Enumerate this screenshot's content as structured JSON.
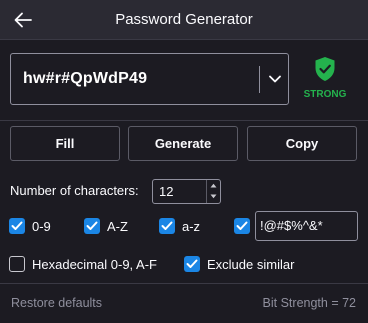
{
  "header": {
    "title": "Password Generator",
    "back_icon": "arrow-left-icon"
  },
  "password": {
    "value": "hw#r#QpWdP49",
    "dropdown_icon": "chevron-down-icon"
  },
  "strength": {
    "label": "STRONG",
    "icon": "shield-check-icon",
    "color": "#24b24d"
  },
  "actions": {
    "fill": "Fill",
    "generate": "Generate",
    "copy": "Copy"
  },
  "length": {
    "label": "Number of characters:",
    "value": "12"
  },
  "options": {
    "digits": {
      "label": "0-9",
      "checked": true
    },
    "upper": {
      "label": "A-Z",
      "checked": true
    },
    "lower": {
      "label": "a-z",
      "checked": true
    },
    "symbols": {
      "checked": true,
      "value": "!@#$%^&*"
    },
    "hex": {
      "label": "Hexadecimal 0-9, A-F",
      "checked": false
    },
    "exclude_similar": {
      "label": "Exclude similar",
      "checked": true
    }
  },
  "footer": {
    "restore": "Restore defaults",
    "bit_strength": "Bit Strength = 72"
  },
  "colors": {
    "accent": "#1b86e5",
    "background": "#1c1b22",
    "titlebar": "#2b2a33"
  }
}
